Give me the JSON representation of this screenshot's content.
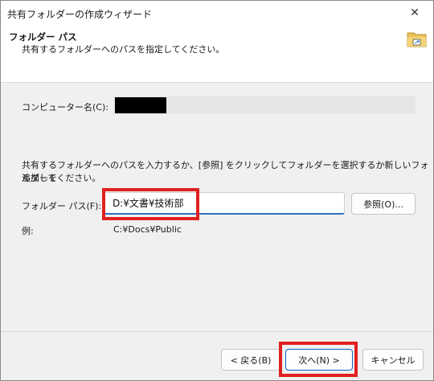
{
  "window": {
    "title": "共有フォルダーの作成ウィザード",
    "close_symbol": "✕"
  },
  "header": {
    "title": "フォルダー パス",
    "subtitle": "共有するフォルダーへのパスを指定してください。",
    "icon": "shared-folder-icon"
  },
  "computer_name": {
    "label": "コンピューター名(C):",
    "value_redacted": true
  },
  "instruction": {
    "line1": "共有するフォルダーへのパスを入力するか、[参照] をクリックしてフォルダーを選択するか新しいフォルダーを",
    "line2": "追加してください。"
  },
  "folder_path": {
    "label": "フォルダー パス(F):",
    "value": "D:¥文書¥技術部",
    "browse_label": "参照(O)..."
  },
  "example": {
    "label": "例:",
    "value": "C:¥Docs¥Public"
  },
  "buttons": {
    "back": "< 戻る(B)",
    "next": "次へ(N) >",
    "cancel": "キャンセル"
  },
  "colors": {
    "highlight": "#e0211f",
    "accent": "#2b6fc2"
  }
}
